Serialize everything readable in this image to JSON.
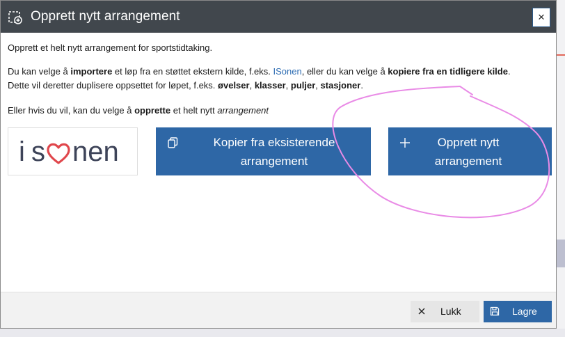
{
  "dialog": {
    "title": "Opprett nytt arrangement",
    "close_symbol": "×",
    "title_icon": "new-event-icon"
  },
  "intro": "Opprett et helt nytt arrangement for sportstidtaking.",
  "import_para": {
    "t1": "Du kan velge å ",
    "b1": "importere",
    "t2": " et løp fra en støttet ekstern kilde, f.eks. ",
    "link": "ISonen",
    "t3": ", eller du kan velge å ",
    "b2": "kopiere fra en tidligere kilde",
    "t4": ".",
    "line2_t1": "Dette vil deretter duplisere oppsettet for løpet, f.eks. ",
    "b3": "øvelser",
    "sep1": ", ",
    "b4": "klasser",
    "sep2": ", ",
    "b5": "puljer",
    "sep3": ", ",
    "b6": "stasjoner",
    "end": "."
  },
  "create_para": {
    "t1": "Eller hvis du vil, kan du velge å ",
    "b1": "opprette",
    "t2": " et helt nytt ",
    "i1": "arrangement"
  },
  "source_logo": {
    "text": "isonen",
    "colors": {
      "text": "#3d4358",
      "heart": "#e0474c"
    }
  },
  "actions": {
    "copy": {
      "line1": "Kopier fra eksisterende",
      "line2": "arrangement",
      "icon": "copy-icon"
    },
    "new": {
      "line1": "Opprett nytt",
      "line2": "arrangement",
      "icon": "plus-icon"
    }
  },
  "footer": {
    "close_label": "Lukk",
    "close_icon": "close-icon",
    "save_label": "Lagre",
    "save_icon": "save-icon"
  },
  "colors": {
    "titlebar": "#41474d",
    "primary": "#2e67a6",
    "link": "#2e6db3",
    "annotation": "#e98be6"
  }
}
